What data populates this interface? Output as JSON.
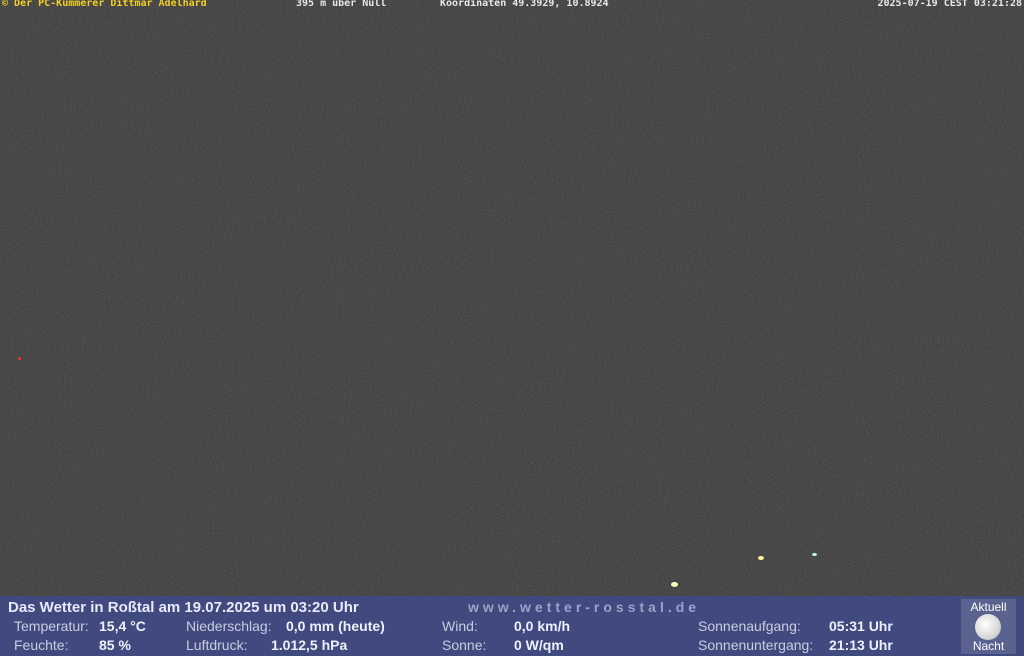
{
  "header": {
    "copyright": "© Der PC-Kümmerer Dittmar Adelhard",
    "altitude": "395 m über Null",
    "coordinates": "Koordinaten 49.3929, 10.8924",
    "timestamp": "2025-07-19 CEST 03:21:28"
  },
  "weather": {
    "title": "Das Wetter in Roßtal am 19.07.2025 um 03:20 Uhr",
    "url": "www.wetter-rosstal.de",
    "temperature_label": "Temperatur:",
    "temperature_value": "15,4 °C",
    "humidity_label": "Feuchte:",
    "humidity_value": "85 %",
    "precip_label": "Niederschlag:",
    "precip_value": "0,0 mm (heute)",
    "pressure_label": "Luftdruck:",
    "pressure_value": "1.012,5 hPa",
    "wind_label": "Wind:",
    "wind_value": "0,0 km/h",
    "sun_label": "Sonne:",
    "sun_value": "0 W/qm",
    "sunrise_label": "Sonnenaufgang:",
    "sunrise_value": "05:31 Uhr",
    "sunset_label": "Sonnenuntergang:",
    "sunset_value": "21:13 Uhr"
  },
  "moon": {
    "top_label": "Aktuell",
    "bottom_label": "Nacht",
    "icon": "moon-icon"
  },
  "colors": {
    "bar": "#404a7e",
    "copyright_text": "#f0d020"
  }
}
